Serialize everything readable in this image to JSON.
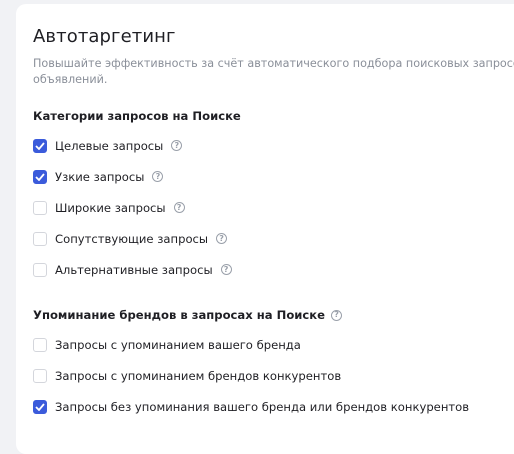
{
  "title": "Автотаргетинг",
  "description_line1": "Повышайте эффективность за счёт автоматического подбора поисковых запросов",
  "description_line2": "объявлений.",
  "categories": {
    "heading": "Категории запросов на Поиске",
    "items": [
      {
        "label": "Целевые запросы",
        "checked": true,
        "help": true
      },
      {
        "label": "Узкие запросы",
        "checked": true,
        "help": true
      },
      {
        "label": "Широкие запросы",
        "checked": false,
        "help": true
      },
      {
        "label": "Сопутствующие запросы",
        "checked": false,
        "help": true
      },
      {
        "label": "Альтернативные запросы",
        "checked": false,
        "help": true
      }
    ]
  },
  "brands": {
    "heading": "Упоминание брендов в запросах на Поиске",
    "items": [
      {
        "label": "Запросы с упоминанием вашего бренда",
        "checked": false,
        "help": false
      },
      {
        "label": "Запросы с упоминанием брендов конкурентов",
        "checked": false,
        "help": false
      },
      {
        "label": "Запросы без упоминания вашего бренда или брендов конкурентов",
        "checked": true,
        "help": false
      }
    ]
  },
  "colors": {
    "accent": "#3b5bdb",
    "muted_text": "#8a8f99",
    "background": "#f1f2f5"
  },
  "icons": {
    "checkmark": "check-icon",
    "help": "question-circle-icon"
  },
  "help_glyph": "?"
}
